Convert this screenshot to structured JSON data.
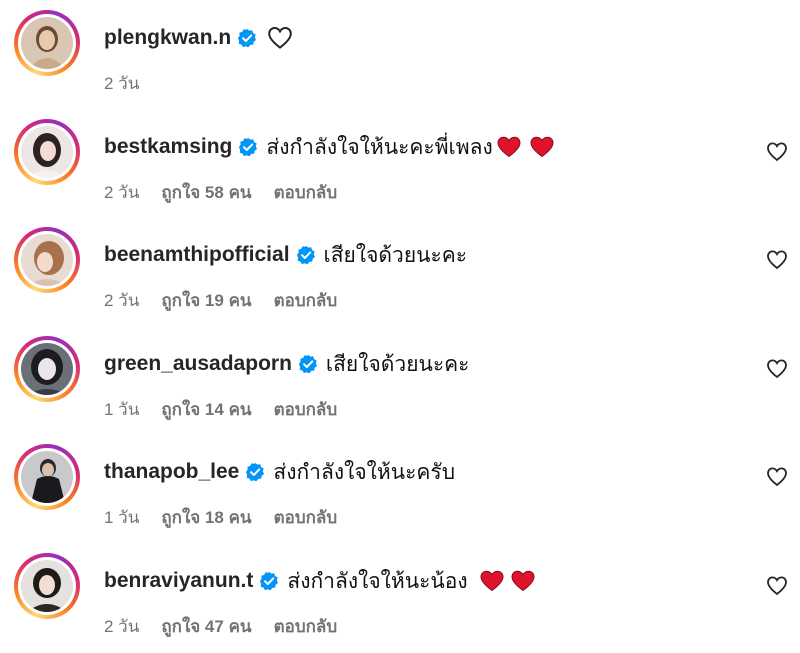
{
  "caption": {
    "username": "plengkwan.n",
    "time": "2 วัน",
    "verified_icon": "verified-badge-icon",
    "heart_icon": "heart-outline-icon"
  },
  "colors": {
    "verified": "#0095f6",
    "heart_red": "#e0132d",
    "meta_gray": "#737373"
  },
  "comments": [
    {
      "username": "bestkamsing",
      "text": "ส่งกำลังใจให้นะคะพี่เพลง",
      "hearts": 2,
      "time": "2 วัน",
      "likes": "ถูกใจ 58 คน",
      "reply": "ตอบกลับ"
    },
    {
      "username": "beenamthipofficial",
      "text": "เสียใจด้วยนะคะ",
      "hearts": 0,
      "time": "2 วัน",
      "likes": "ถูกใจ 19 คน",
      "reply": "ตอบกลับ"
    },
    {
      "username": "green_ausadaporn",
      "text": "เสียใจด้วยนะคะ",
      "hearts": 0,
      "time": "1 วัน",
      "likes": "ถูกใจ 14 คน",
      "reply": "ตอบกลับ"
    },
    {
      "username": "thanapob_lee",
      "text": "ส่งกำลังใจให้นะครับ",
      "hearts": 0,
      "time": "1 วัน",
      "likes": "ถูกใจ 18 คน",
      "reply": "ตอบกลับ"
    },
    {
      "username": "benraviyanun.t",
      "text": "ส่งกำลังใจให้นะน้อง",
      "hearts": 2,
      "time": "2 วัน",
      "likes": "ถูกใจ 47 คน",
      "reply": "ตอบกลับ"
    }
  ]
}
